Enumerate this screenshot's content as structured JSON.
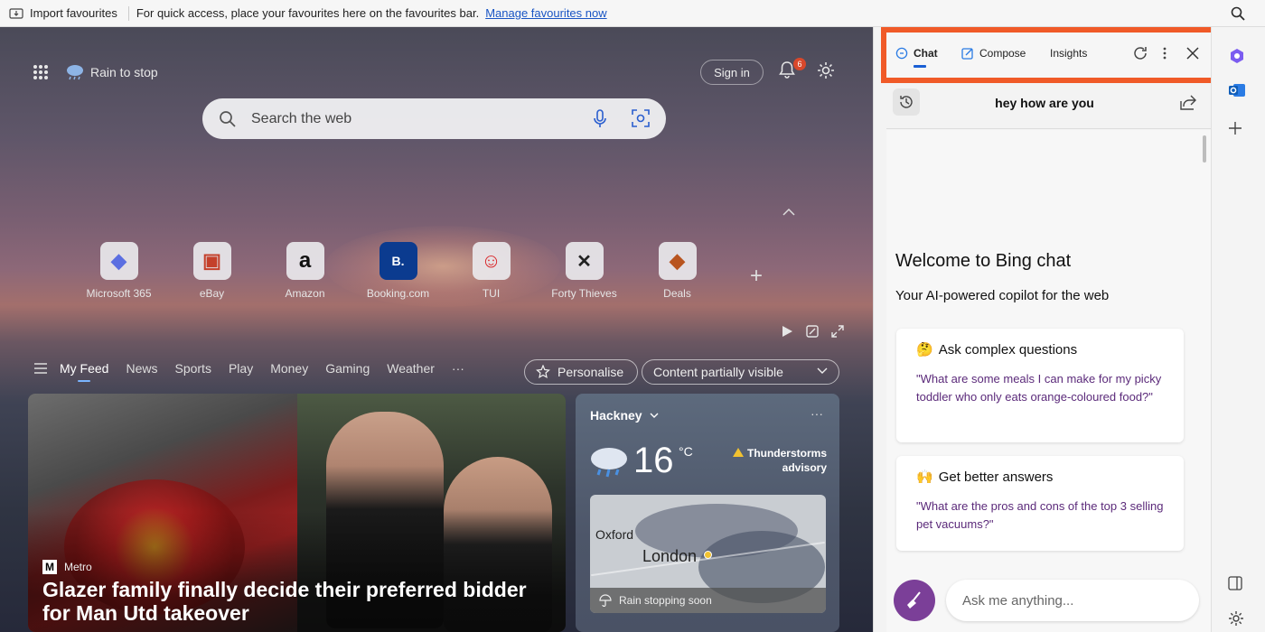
{
  "favbar": {
    "import_label": "Import favourites",
    "message": "For quick access, place your favourites here on the favourites bar.",
    "manage_link": "Manage favourites now"
  },
  "newtab": {
    "weather_text": "Rain to stop",
    "signin_label": "Sign in",
    "notification_count": "6",
    "search_placeholder": "Search the web",
    "tiles": [
      {
        "label": "Microsoft 365",
        "glyph": "◆",
        "color": "#5b6ee1"
      },
      {
        "label": "eBay",
        "glyph": "▣",
        "color": "#c4402b"
      },
      {
        "label": "Amazon",
        "glyph": "a",
        "color": "#111111"
      },
      {
        "label": "Booking.com",
        "glyph": "B.",
        "color": "#0b3b8f"
      },
      {
        "label": "TUI",
        "glyph": "☺",
        "color": "#d9262a"
      },
      {
        "label": "Forty Thieves",
        "glyph": "✕",
        "color": "#222222"
      },
      {
        "label": "Deals",
        "glyph": "◆",
        "color": "#b8541f"
      }
    ],
    "feed_nav": [
      "My Feed",
      "News",
      "Sports",
      "Play",
      "Money",
      "Gaming",
      "Weather",
      "···"
    ],
    "personalise_label": "Personalise",
    "content_visibility": "Content partially visible"
  },
  "news": {
    "source": "Metro",
    "source_logo": "M",
    "headline": "Glazer family finally decide their preferred bidder for Man Utd takeover"
  },
  "weather": {
    "location": "Hackney",
    "more": "···",
    "temperature": "16",
    "unit": "°C",
    "advisory": "Thunderstorms advisory",
    "map_city_1": "Oxford",
    "map_city_2": "London",
    "forecast": "Rain stopping soon"
  },
  "copilot": {
    "tabs": {
      "chat": "Chat",
      "compose": "Compose",
      "insights": "Insights"
    },
    "conversation_title": "hey how are you",
    "welcome_title": "Welcome to Bing chat",
    "welcome_subtitle": "Your AI-powered copilot for the web",
    "cards": [
      {
        "emoji": "🤔",
        "title": "Ask complex questions",
        "body": "\"What are some meals I can make for my picky toddler who only eats orange-coloured food?\""
      },
      {
        "emoji": "🙌",
        "title": "Get better answers",
        "body": "\"What are the pros and cons of the top 3 selling pet vacuums?\""
      }
    ],
    "input_placeholder": "Ask me anything..."
  },
  "colors": {
    "highlight_border": "#f05a28",
    "active_tab_underline": "#1a5fd4",
    "prompt_text": "#5b2a7a"
  }
}
